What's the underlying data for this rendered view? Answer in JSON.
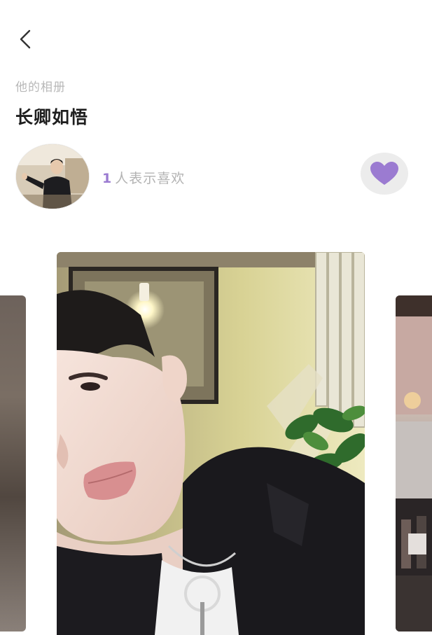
{
  "header": {
    "back_icon": "chevron-left-icon"
  },
  "album": {
    "section_label": "他的相册",
    "title": "长卿如悟"
  },
  "likes": {
    "count": "1",
    "text": "人表示喜欢",
    "like_icon": "heart-icon",
    "accent_color": "#9b7bd1"
  },
  "carousel": {
    "cards": [
      "photo-previous",
      "photo-current",
      "photo-next"
    ]
  }
}
